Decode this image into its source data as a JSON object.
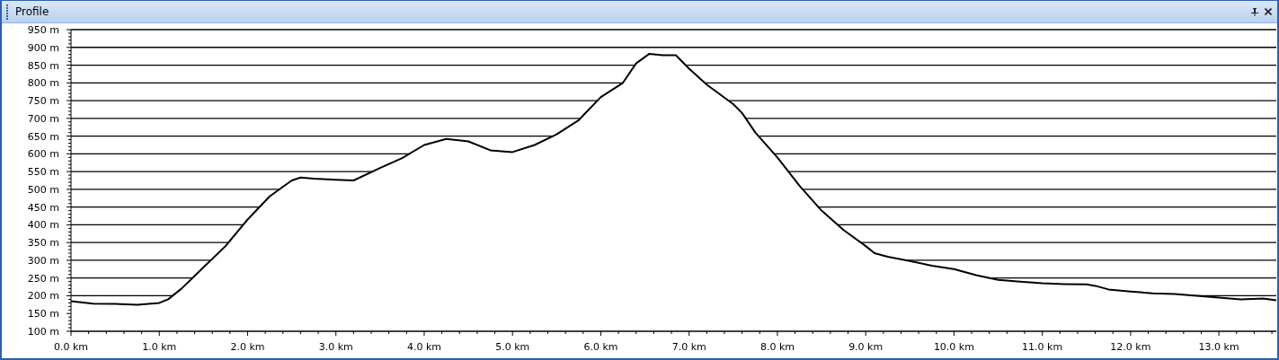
{
  "window": {
    "title": "Profile"
  },
  "profile": {
    "chart_data": {
      "type": "area",
      "grid": true,
      "xlim": [
        0,
        13.65
      ],
      "ylim": [
        100,
        950
      ],
      "x": [
        0,
        0.25,
        0.5,
        0.75,
        1.0,
        1.1,
        1.25,
        1.5,
        1.75,
        2.0,
        2.25,
        2.5,
        2.6,
        2.75,
        3.0,
        3.2,
        3.5,
        3.75,
        4.0,
        4.25,
        4.5,
        4.75,
        5.0,
        5.25,
        5.5,
        5.75,
        6.0,
        6.25,
        6.4,
        6.55,
        6.7,
        6.85,
        7.0,
        7.2,
        7.5,
        7.6,
        7.75,
        8.0,
        8.25,
        8.5,
        8.75,
        9.0,
        9.1,
        9.25,
        9.5,
        9.75,
        10.0,
        10.25,
        10.5,
        10.75,
        11.0,
        11.25,
        11.5,
        11.6,
        11.75,
        12.0,
        12.25,
        12.5,
        12.75,
        13.0,
        13.25,
        13.5,
        13.65
      ],
      "series": [
        {
          "color": "#000000",
          "values": [
            185,
            178,
            177,
            175,
            180,
            190,
            220,
            280,
            340,
            415,
            480,
            525,
            533,
            530,
            527,
            525,
            560,
            588,
            625,
            642,
            635,
            610,
            605,
            625,
            655,
            695,
            760,
            800,
            855,
            882,
            878,
            878,
            840,
            795,
            740,
            715,
            660,
            590,
            510,
            440,
            385,
            340,
            320,
            310,
            298,
            285,
            275,
            258,
            245,
            240,
            235,
            233,
            232,
            228,
            218,
            212,
            207,
            205,
            200,
            195,
            190,
            192,
            187
          ]
        }
      ],
      "xticks": [
        {
          "value": 0,
          "label": "0.0 km"
        },
        {
          "value": 1,
          "label": "1.0 km"
        },
        {
          "value": 2,
          "label": "2.0 km"
        },
        {
          "value": 3,
          "label": "3.0 km"
        },
        {
          "value": 4,
          "label": "4.0 km"
        },
        {
          "value": 5,
          "label": "5.0 km"
        },
        {
          "value": 6,
          "label": "6.0 km"
        },
        {
          "value": 7,
          "label": "7.0 km"
        },
        {
          "value": 8,
          "label": "8.0 km"
        },
        {
          "value": 9,
          "label": "9.0 km"
        },
        {
          "value": 10,
          "label": "10.0 km"
        },
        {
          "value": 11,
          "label": "11.0 km"
        },
        {
          "value": 12,
          "label": "12.0 km"
        },
        {
          "value": 13,
          "label": "13.0 km"
        }
      ],
      "yticks": [
        {
          "value": 950,
          "label": "950 m"
        },
        {
          "value": 900,
          "label": "900 m"
        },
        {
          "value": 850,
          "label": "850 m"
        },
        {
          "value": 800,
          "label": "800 m"
        },
        {
          "value": 750,
          "label": "750 m"
        },
        {
          "value": 700,
          "label": "700 m"
        },
        {
          "value": 650,
          "label": "650 m"
        },
        {
          "value": 600,
          "label": "600 m"
        },
        {
          "value": 550,
          "label": "550 m"
        },
        {
          "value": 500,
          "label": "500 m"
        },
        {
          "value": 450,
          "label": "450 m"
        },
        {
          "value": 400,
          "label": "400 m"
        },
        {
          "value": 350,
          "label": "350 m"
        },
        {
          "value": 300,
          "label": "300 m"
        },
        {
          "value": 250,
          "label": "250 m"
        },
        {
          "value": 200,
          "label": "200 m"
        },
        {
          "value": 150,
          "label": "150 m"
        },
        {
          "value": 100,
          "label": "100 m"
        }
      ]
    }
  }
}
